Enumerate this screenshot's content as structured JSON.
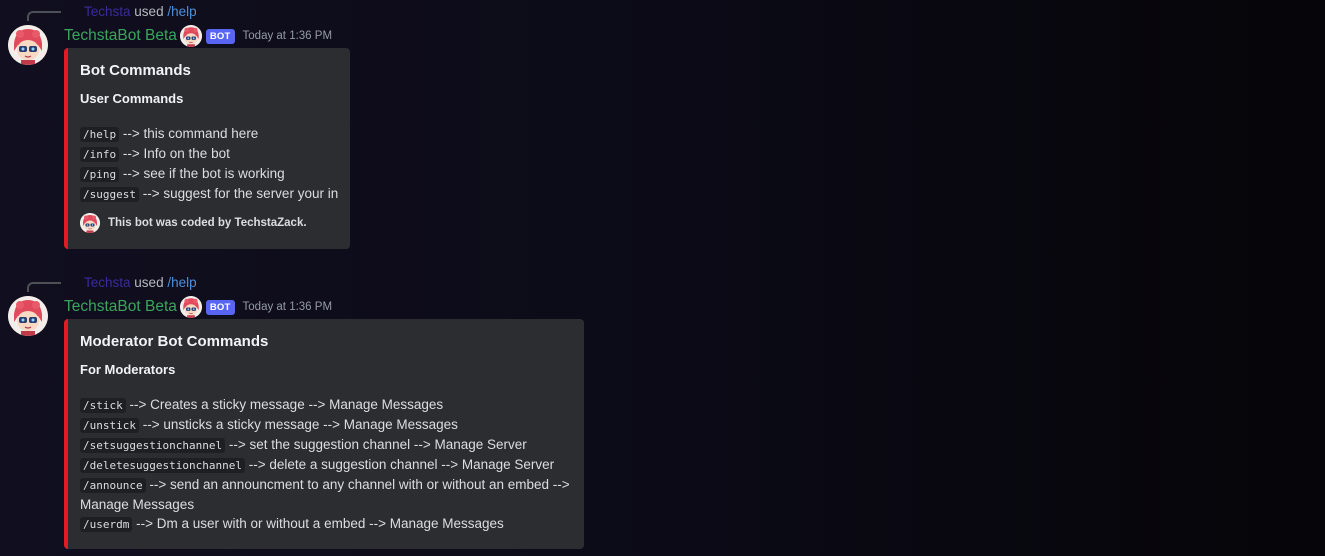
{
  "messages": [
    {
      "reply": {
        "user": "Techsta",
        "used": "used",
        "command": "/help"
      },
      "author": "TechstaBot Beta",
      "bot_tag": "BOT",
      "timestamp": "Today at 1:36 PM",
      "embed": {
        "title": "Bot Commands",
        "subtitle": "User Commands",
        "commands": [
          {
            "cmd": "/help",
            "text": "--> this command here"
          },
          {
            "cmd": "/info",
            "text": "--> Info on the bot"
          },
          {
            "cmd": "/ping",
            "text": "--> see if the bot is working"
          },
          {
            "cmd": "/suggest",
            "text": "--> suggest for the server your in"
          }
        ],
        "footer": "This bot was coded by TechstaZack."
      }
    },
    {
      "reply": {
        "user": "Techsta",
        "used": "used",
        "command": "/help"
      },
      "author": "TechstaBot Beta",
      "bot_tag": "BOT",
      "timestamp": "Today at 1:36 PM",
      "embed": {
        "title": "Moderator Bot Commands",
        "subtitle": "For Moderators",
        "commands": [
          {
            "cmd": "/stick",
            "text": "--> Creates a sticky message --> Manage Messages"
          },
          {
            "cmd": "/unstick",
            "text": "--> unsticks a sticky message --> Manage Messages"
          },
          {
            "cmd": "/setsuggestionchannel",
            "text": "--> set the suggestion channel --> Manage Server"
          },
          {
            "cmd": "/deletesuggestionchannel",
            "text": "--> delete a suggestion channel --> Manage Server"
          },
          {
            "cmd": "/announce",
            "text": "--> send an announcment to any channel with or without an embed --> Manage Messages"
          },
          {
            "cmd": "/userdm",
            "text": "--> Dm a user with or without a embed --> Manage Messages"
          }
        ]
      }
    }
  ],
  "colors": {
    "embed_border": "#e21b23",
    "username": "#3ba55c",
    "bot_tag": "#5865f2",
    "reply_command": "#4f8fd8"
  },
  "icons": {
    "avatar": "anime-robot-girl-avatar-icon",
    "bot_emoji": "robot-face-emoji-icon",
    "footer_icon": "footer-avatar-icon"
  }
}
